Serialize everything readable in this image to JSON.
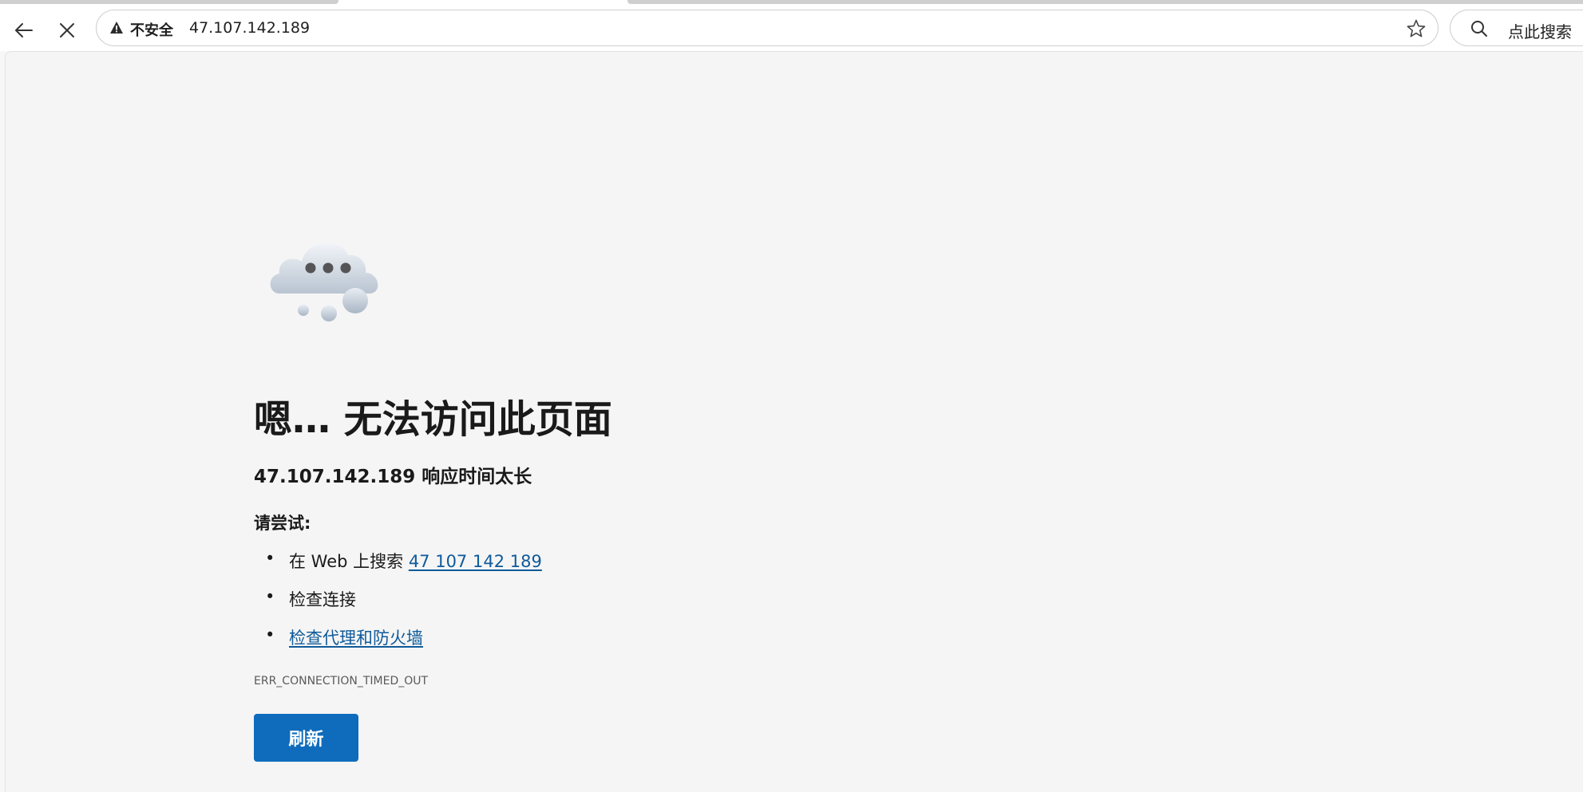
{
  "browser": {
    "security_label": "不安全",
    "url": "47.107.142.189",
    "search_placeholder": "点此搜索",
    "icons": {
      "back": "back-arrow-icon",
      "stop": "close-icon",
      "warning": "warning-icon",
      "favorite": "star-icon",
      "search": "search-icon"
    }
  },
  "error_page": {
    "title": "嗯… 无法访问此页面",
    "subtitle": "47.107.142.189 响应时间太长",
    "try_label": "请尝试:",
    "suggestions": [
      {
        "prefix": "在 Web 上搜索 ",
        "link": "47 107 142 189"
      },
      {
        "text": "检查连接"
      },
      {
        "link": "检查代理和防火墙"
      }
    ],
    "error_code": "ERR_CONNECTION_TIMED_OUT",
    "refresh_label": "刷新",
    "illustration": "cloud-icon"
  },
  "colors": {
    "accent": "#0f6cbd",
    "link": "#0f5a9a",
    "page_background": "#f5f5f5"
  }
}
